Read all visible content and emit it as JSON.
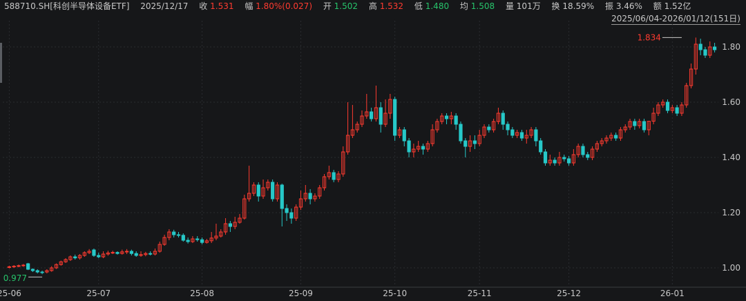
{
  "header": {
    "symbol": "588710.SH[科创半导体设备ETF]",
    "date": "2025/12/17",
    "close_label": "收",
    "close": "1.531",
    "change_label": "幅",
    "change": "1.80%(0.027)",
    "open_label": "开",
    "open": "1.502",
    "high_label": "高",
    "high": "1.532",
    "low_label": "低",
    "low": "1.480",
    "avg_label": "均",
    "avg": "1.508",
    "volume_label": "量",
    "volume": "101万",
    "turnover_label": "换",
    "turnover": "18.59%",
    "amplitude_label": "振",
    "amplitude": "3.46%",
    "amount_label": "额",
    "amount": "1.52亿"
  },
  "range_label": "2025/06/04-2026/01/12(151日)",
  "colors": {
    "up": "#ff3b30",
    "down": "#27c8c8",
    "background": "#161719",
    "low_marker": "#27c46b"
  },
  "chart_data": {
    "type": "candlestick",
    "y_ticks": [
      "1.00",
      "1.20",
      "1.40",
      "1.60",
      "1.80"
    ],
    "ylim": [
      0.94,
      1.87
    ],
    "x_ticks": [
      {
        "label": "25-06",
        "index": 0
      },
      {
        "label": "25-07",
        "index": 19
      },
      {
        "label": "25-08",
        "index": 41
      },
      {
        "label": "25-09",
        "index": 62
      },
      {
        "label": "25-10",
        "index": 82
      },
      {
        "label": "25-11",
        "index": 100
      },
      {
        "label": "25-12",
        "index": 119
      },
      {
        "label": "26-01",
        "index": 141
      }
    ],
    "high_annotation": {
      "value": "1.834",
      "index": 143
    },
    "low_annotation": {
      "value": "0.977",
      "index": 7
    },
    "candles": [
      [
        1.002,
        1.004,
        0.998,
        1.008
      ],
      [
        1.004,
        1.006,
        1.0,
        1.01
      ],
      [
        1.006,
        1.008,
        1.002,
        1.012
      ],
      [
        1.008,
        1.01,
        1.004,
        1.014
      ],
      [
        1.015,
        0.995,
        0.992,
        1.018
      ],
      [
        0.995,
        0.99,
        0.985,
        0.998
      ],
      [
        0.99,
        0.985,
        0.98,
        0.995
      ],
      [
        0.985,
        0.983,
        0.977,
        0.99
      ],
      [
        0.985,
        0.99,
        0.98,
        0.995
      ],
      [
        0.99,
        1.0,
        0.986,
        1.006
      ],
      [
        1.0,
        1.012,
        0.996,
        1.016
      ],
      [
        1.012,
        1.022,
        1.008,
        1.026
      ],
      [
        1.022,
        1.03,
        1.018,
        1.035
      ],
      [
        1.03,
        1.04,
        1.025,
        1.045
      ],
      [
        1.04,
        1.036,
        1.03,
        1.048
      ],
      [
        1.036,
        1.045,
        1.03,
        1.05
      ],
      [
        1.045,
        1.055,
        1.04,
        1.06
      ],
      [
        1.055,
        1.06,
        1.05,
        1.068
      ],
      [
        1.065,
        1.045,
        1.04,
        1.07
      ],
      [
        1.045,
        1.04,
        1.035,
        1.055
      ],
      [
        1.04,
        1.05,
        1.035,
        1.06
      ],
      [
        1.05,
        1.054,
        1.044,
        1.062
      ],
      [
        1.054,
        1.056,
        1.05,
        1.062
      ],
      [
        1.056,
        1.052,
        1.048,
        1.06
      ],
      [
        1.052,
        1.058,
        1.048,
        1.066
      ],
      [
        1.058,
        1.06,
        1.05,
        1.068
      ],
      [
        1.06,
        1.052,
        1.045,
        1.066
      ],
      [
        1.052,
        1.045,
        1.04,
        1.06
      ],
      [
        1.045,
        1.048,
        1.04,
        1.06
      ],
      [
        1.048,
        1.052,
        1.042,
        1.058
      ],
      [
        1.052,
        1.05,
        1.045,
        1.06
      ],
      [
        1.05,
        1.06,
        1.045,
        1.07
      ],
      [
        1.06,
        1.085,
        1.055,
        1.095
      ],
      [
        1.085,
        1.11,
        1.08,
        1.12
      ],
      [
        1.11,
        1.13,
        1.1,
        1.14
      ],
      [
        1.13,
        1.12,
        1.11,
        1.138
      ],
      [
        1.12,
        1.118,
        1.11,
        1.13
      ],
      [
        1.118,
        1.1,
        1.095,
        1.125
      ],
      [
        1.1,
        1.095,
        1.088,
        1.11
      ],
      [
        1.095,
        1.105,
        1.09,
        1.115
      ],
      [
        1.105,
        1.102,
        1.095,
        1.115
      ],
      [
        1.102,
        1.092,
        1.085,
        1.11
      ],
      [
        1.092,
        1.098,
        1.088,
        1.105
      ],
      [
        1.098,
        1.108,
        1.09,
        1.13
      ],
      [
        1.108,
        1.115,
        1.1,
        1.16
      ],
      [
        1.115,
        1.13,
        1.11,
        1.14
      ],
      [
        1.13,
        1.16,
        1.12,
        1.18
      ],
      [
        1.16,
        1.15,
        1.13,
        1.17
      ],
      [
        1.15,
        1.165,
        1.14,
        1.185
      ],
      [
        1.165,
        1.18,
        1.16,
        1.195
      ],
      [
        1.18,
        1.25,
        1.175,
        1.265
      ],
      [
        1.25,
        1.27,
        1.24,
        1.37
      ],
      [
        1.27,
        1.3,
        1.26,
        1.31
      ],
      [
        1.3,
        1.26,
        1.24,
        1.31
      ],
      [
        1.26,
        1.29,
        1.25,
        1.32
      ],
      [
        1.29,
        1.31,
        1.28,
        1.32
      ],
      [
        1.31,
        1.25,
        1.24,
        1.32
      ],
      [
        1.25,
        1.3,
        1.24,
        1.31
      ],
      [
        1.3,
        1.215,
        1.15,
        1.305
      ],
      [
        1.215,
        1.2,
        1.17,
        1.23
      ],
      [
        1.2,
        1.18,
        1.16,
        1.215
      ],
      [
        1.18,
        1.22,
        1.17,
        1.23
      ],
      [
        1.22,
        1.25,
        1.21,
        1.28
      ],
      [
        1.25,
        1.27,
        1.24,
        1.3
      ],
      [
        1.27,
        1.25,
        1.23,
        1.285
      ],
      [
        1.25,
        1.26,
        1.24,
        1.27
      ],
      [
        1.26,
        1.29,
        1.25,
        1.3
      ],
      [
        1.29,
        1.33,
        1.28,
        1.34
      ],
      [
        1.33,
        1.345,
        1.32,
        1.37
      ],
      [
        1.345,
        1.32,
        1.31,
        1.355
      ],
      [
        1.32,
        1.34,
        1.31,
        1.35
      ],
      [
        1.34,
        1.42,
        1.33,
        1.44
      ],
      [
        1.42,
        1.48,
        1.41,
        1.6
      ],
      [
        1.48,
        1.5,
        1.47,
        1.59
      ],
      [
        1.5,
        1.52,
        1.49,
        1.53
      ],
      [
        1.52,
        1.55,
        1.51,
        1.57
      ],
      [
        1.55,
        1.565,
        1.54,
        1.63
      ],
      [
        1.565,
        1.54,
        1.53,
        1.58
      ],
      [
        1.54,
        1.58,
        1.53,
        1.66
      ],
      [
        1.58,
        1.52,
        1.49,
        1.6
      ],
      [
        1.52,
        1.56,
        1.51,
        1.61
      ],
      [
        1.56,
        1.61,
        1.54,
        1.63
      ],
      [
        1.61,
        1.48,
        1.46,
        1.62
      ],
      [
        1.48,
        1.5,
        1.47,
        1.51
      ],
      [
        1.5,
        1.46,
        1.44,
        1.51
      ],
      [
        1.46,
        1.42,
        1.4,
        1.47
      ],
      [
        1.42,
        1.43,
        1.4,
        1.45
      ],
      [
        1.43,
        1.44,
        1.42,
        1.46
      ],
      [
        1.44,
        1.43,
        1.41,
        1.45
      ],
      [
        1.43,
        1.45,
        1.42,
        1.46
      ],
      [
        1.45,
        1.5,
        1.44,
        1.52
      ],
      [
        1.5,
        1.53,
        1.49,
        1.54
      ],
      [
        1.53,
        1.55,
        1.52,
        1.56
      ],
      [
        1.55,
        1.54,
        1.52,
        1.56
      ],
      [
        1.54,
        1.55,
        1.52,
        1.565
      ],
      [
        1.55,
        1.52,
        1.5,
        1.56
      ],
      [
        1.52,
        1.46,
        1.45,
        1.53
      ],
      [
        1.46,
        1.44,
        1.4,
        1.47
      ],
      [
        1.44,
        1.46,
        1.42,
        1.48
      ],
      [
        1.46,
        1.45,
        1.43,
        1.48
      ],
      [
        1.45,
        1.48,
        1.44,
        1.5
      ],
      [
        1.48,
        1.51,
        1.47,
        1.52
      ],
      [
        1.51,
        1.5,
        1.49,
        1.52
      ],
      [
        1.5,
        1.53,
        1.49,
        1.54
      ],
      [
        1.53,
        1.56,
        1.52,
        1.58
      ],
      [
        1.56,
        1.52,
        1.5,
        1.57
      ],
      [
        1.52,
        1.5,
        1.48,
        1.53
      ],
      [
        1.5,
        1.48,
        1.47,
        1.51
      ],
      [
        1.48,
        1.49,
        1.47,
        1.5
      ],
      [
        1.49,
        1.47,
        1.46,
        1.5
      ],
      [
        1.47,
        1.48,
        1.45,
        1.5
      ],
      [
        1.48,
        1.5,
        1.47,
        1.51
      ],
      [
        1.5,
        1.46,
        1.44,
        1.51
      ],
      [
        1.46,
        1.42,
        1.41,
        1.47
      ],
      [
        1.42,
        1.38,
        1.37,
        1.43
      ],
      [
        1.38,
        1.39,
        1.37,
        1.41
      ],
      [
        1.39,
        1.38,
        1.37,
        1.4
      ],
      [
        1.38,
        1.4,
        1.37,
        1.42
      ],
      [
        1.4,
        1.395,
        1.385,
        1.41
      ],
      [
        1.395,
        1.38,
        1.37,
        1.405
      ],
      [
        1.38,
        1.41,
        1.37,
        1.43
      ],
      [
        1.41,
        1.44,
        1.4,
        1.45
      ],
      [
        1.44,
        1.41,
        1.4,
        1.45
      ],
      [
        1.41,
        1.4,
        1.39,
        1.42
      ],
      [
        1.4,
        1.43,
        1.39,
        1.44
      ],
      [
        1.43,
        1.45,
        1.42,
        1.46
      ],
      [
        1.45,
        1.46,
        1.44,
        1.47
      ],
      [
        1.46,
        1.47,
        1.45,
        1.48
      ],
      [
        1.47,
        1.48,
        1.46,
        1.49
      ],
      [
        1.48,
        1.47,
        1.46,
        1.49
      ],
      [
        1.47,
        1.5,
        1.46,
        1.51
      ],
      [
        1.5,
        1.51,
        1.49,
        1.52
      ],
      [
        1.51,
        1.53,
        1.5,
        1.54
      ],
      [
        1.53,
        1.515,
        1.5,
        1.54
      ],
      [
        1.515,
        1.53,
        1.505,
        1.54
      ],
      [
        1.53,
        1.5,
        1.49,
        1.54
      ],
      [
        1.5,
        1.531,
        1.48,
        1.532
      ],
      [
        1.531,
        1.56,
        1.52,
        1.58
      ],
      [
        1.56,
        1.59,
        1.55,
        1.6
      ],
      [
        1.59,
        1.6,
        1.58,
        1.61
      ],
      [
        1.6,
        1.57,
        1.56,
        1.61
      ],
      [
        1.57,
        1.58,
        1.56,
        1.59
      ],
      [
        1.58,
        1.56,
        1.55,
        1.59
      ],
      [
        1.56,
        1.59,
        1.55,
        1.6
      ],
      [
        1.59,
        1.66,
        1.58,
        1.67
      ],
      [
        1.66,
        1.72,
        1.65,
        1.74
      ],
      [
        1.72,
        1.81,
        1.7,
        1.834
      ],
      [
        1.81,
        1.79,
        1.77,
        1.83
      ],
      [
        1.79,
        1.77,
        1.76,
        1.8
      ],
      [
        1.77,
        1.8,
        1.76,
        1.82
      ],
      [
        1.8,
        1.79,
        1.78,
        1.815
      ]
    ]
  }
}
